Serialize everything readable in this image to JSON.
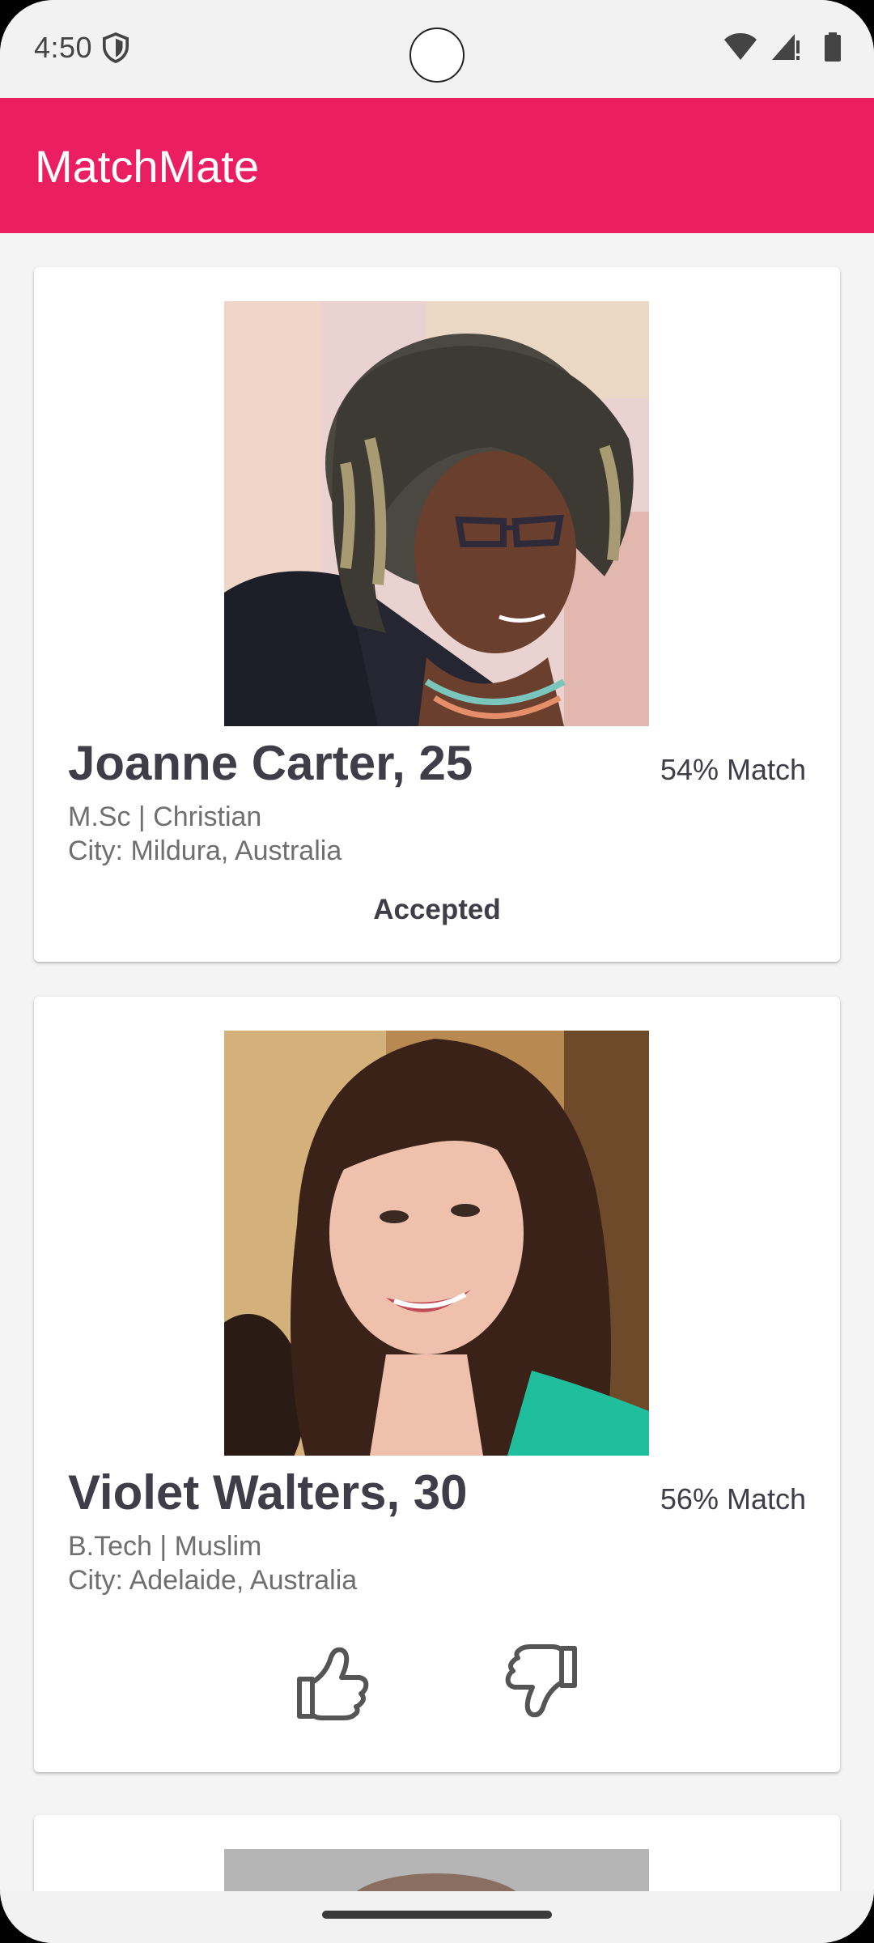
{
  "status_bar": {
    "time": "4:50"
  },
  "app_bar": {
    "title": "MatchMate"
  },
  "profiles": [
    {
      "name_age": "Joanne Carter, 25",
      "match": "54% Match",
      "education_religion": "M.Sc | Christian",
      "city": "City: Mildura, Australia",
      "status": "Accepted"
    },
    {
      "name_age": "Violet Walters, 30",
      "match": "56% Match",
      "education_religion": "B.Tech | Muslim",
      "city": "City: Adelaide, Australia",
      "actions": {
        "accept_icon": "thumbs-up-icon",
        "reject_icon": "thumbs-down-icon"
      }
    }
  ],
  "colors": {
    "app_bar": "#ec1e62",
    "text_primary": "#3f3d47",
    "text_secondary": "#6f6f6f"
  }
}
